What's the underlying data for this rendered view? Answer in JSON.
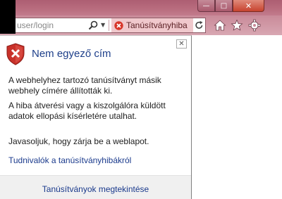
{
  "window": {
    "minimize_glyph": "—",
    "maximize_glyph": "□",
    "close_glyph": "✕"
  },
  "address_bar": {
    "url": "user/login",
    "search_icon": "search-icon",
    "dropdown_glyph": "▼",
    "cert_error_label": "Tanúsítványhiba",
    "refresh_icon": "refresh-icon"
  },
  "toolbar": {
    "icons": [
      "home-icon",
      "star-icon",
      "gear-icon"
    ]
  },
  "popup": {
    "close_glyph": "✕",
    "icon": "shield-error-icon",
    "title": "Nem egyező cím",
    "paragraph1": "A webhelyhez tartozó tanúsítványt másik webhely címére állították ki.",
    "paragraph2": "A hiba átverési vagy a kiszolgálóra küldött adatok ellopási kísérletére utalhat.",
    "paragraph3": "Javasoljuk, hogy zárja be a weblapot.",
    "about_link": "Tudnivalók a tanúsítványhibákról",
    "view_certs_link": "Tanúsítványok megtekintése"
  },
  "colors": {
    "title_blue": "#1e3f8a",
    "link_blue": "#1a3a8c",
    "titlebar": "#b96d7f",
    "error_red": "#c7432f",
    "error_pill": "#f0c8cc"
  }
}
